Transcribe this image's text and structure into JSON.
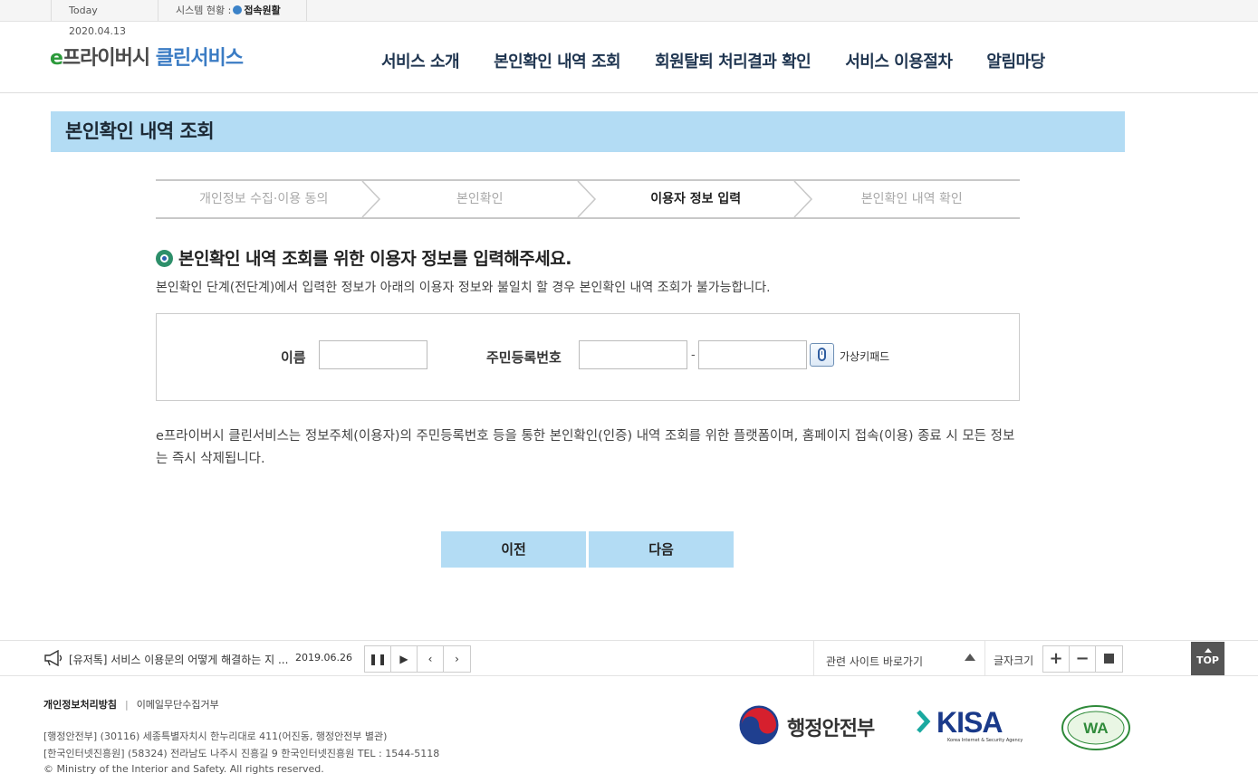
{
  "topbar": {
    "today_label": "Today",
    "today_date": "2020.04.13",
    "status_label": "시스템 현황 :",
    "status_value": "접속원활"
  },
  "header": {
    "logo_e": "e",
    "logo_main": "프라이버시",
    "logo_clean": "클린서비스",
    "nav": [
      "서비스 소개",
      "본인확인 내역 조회",
      "회원탈퇴 처리결과 확인",
      "서비스 이용절차",
      "알림마당"
    ]
  },
  "page_title": "본인확인 내역 조회",
  "steps": [
    {
      "label": "개인정보 수집·이용 동의",
      "active": false
    },
    {
      "label": "본인확인",
      "active": false
    },
    {
      "label": "이용자 정보 입력",
      "active": true
    },
    {
      "label": "본인확인 내역 확인",
      "active": false
    }
  ],
  "section": {
    "title": "본인확인 내역 조회를 위한 이용자 정보를 입력해주세요.",
    "description": "본인확인 단계(전단계)에서 입력한 정보가 아래의 이용자 정보와 불일치 할 경우 본인확인 내역 조회가 불가능합니다."
  },
  "form": {
    "name_label": "이름",
    "name_value": "",
    "rrn_label": "주민등록번호",
    "rrn_front_value": "",
    "rrn_dash": "-",
    "rrn_back_value": "",
    "virtual_keypad_label": "가상키패드"
  },
  "notice": "e프라이버시 클린서비스는 정보주체(이용자)의 주민등록번호 등을 통한 본인확인(인증) 내역 조회를 위한 플랫폼이며, 홈페이지 접속(이용) 종료 시 모든 정보는 즉시 삭제됩니다.",
  "buttons": {
    "prev": "이전",
    "next": "다음"
  },
  "ticker": {
    "text": "[유저톡] 서비스 이용문의 어떻게 해결하는 지 ...",
    "date": "2019.06.26",
    "controls": [
      "pause-icon",
      "play-icon",
      "chevron-left-icon",
      "chevron-right-icon"
    ],
    "related_sites": "관련 사이트 바로가기",
    "font_size_label": "글자크기",
    "top_label": "TOP"
  },
  "footer": {
    "privacy_policy": "개인정보처리방침",
    "email_refusal": "이메일무단수집거부",
    "address1": "[행정안전부] (30116) 세종특별자치시 한누리대로 411(어진동, 행정안전부 별관)",
    "address2": "[한국인터넷진흥원] (58324) 전라남도 나주시 진흥길 9 한국인터넷진흥원 TEL : 1544-5118",
    "copyright": "© Ministry of the Interior and Safety. All rights reserved.",
    "logo_mois": "행정안전부",
    "logo_kisa": "KISA",
    "logo_kisa_sub": "Korea Internet & Security Agency",
    "logo_wa": "WA"
  },
  "colors": {
    "accent_light_blue": "#b3dcf4",
    "logo_green": "#2c9a3b",
    "logo_blue": "#3b7cc4",
    "nav_text": "#1f3550"
  }
}
